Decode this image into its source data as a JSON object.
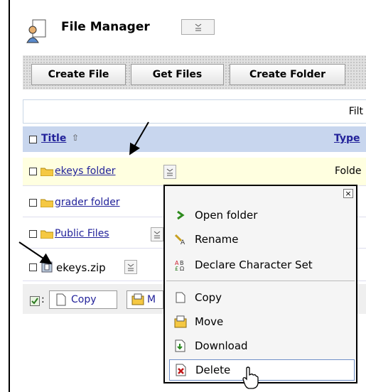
{
  "app": {
    "title": "File Manager"
  },
  "toolbar": {
    "create_file": "Create File",
    "get_files": "Get Files",
    "create_folder": "Create Folder"
  },
  "filter": {
    "label": "Filt"
  },
  "table": {
    "header": {
      "title": "Title",
      "type": "Type"
    },
    "rows": [
      {
        "name": "ekeys folder",
        "type": "Folde"
      },
      {
        "name": "grader folder",
        "type": ""
      },
      {
        "name": "Public Files",
        "type": ""
      },
      {
        "name": "ekeys.zip",
        "type": ""
      }
    ]
  },
  "bulk": {
    "copy": "Copy",
    "move": "M"
  },
  "context_menu": {
    "close": "×",
    "items": [
      {
        "label": "Open folder",
        "icon": "open-folder-icon"
      },
      {
        "label": "Rename",
        "icon": "rename-icon"
      },
      {
        "label": "Declare Character Set",
        "icon": "charset-icon"
      },
      {
        "label": "Copy",
        "icon": "copy-icon"
      },
      {
        "label": "Move",
        "icon": "move-icon"
      },
      {
        "label": "Download",
        "icon": "download-icon"
      },
      {
        "label": "Delete",
        "icon": "delete-icon"
      }
    ]
  },
  "colors": {
    "link": "#22229a",
    "header_row": "#c8d6ee",
    "selected_row": "#ffffe0"
  }
}
